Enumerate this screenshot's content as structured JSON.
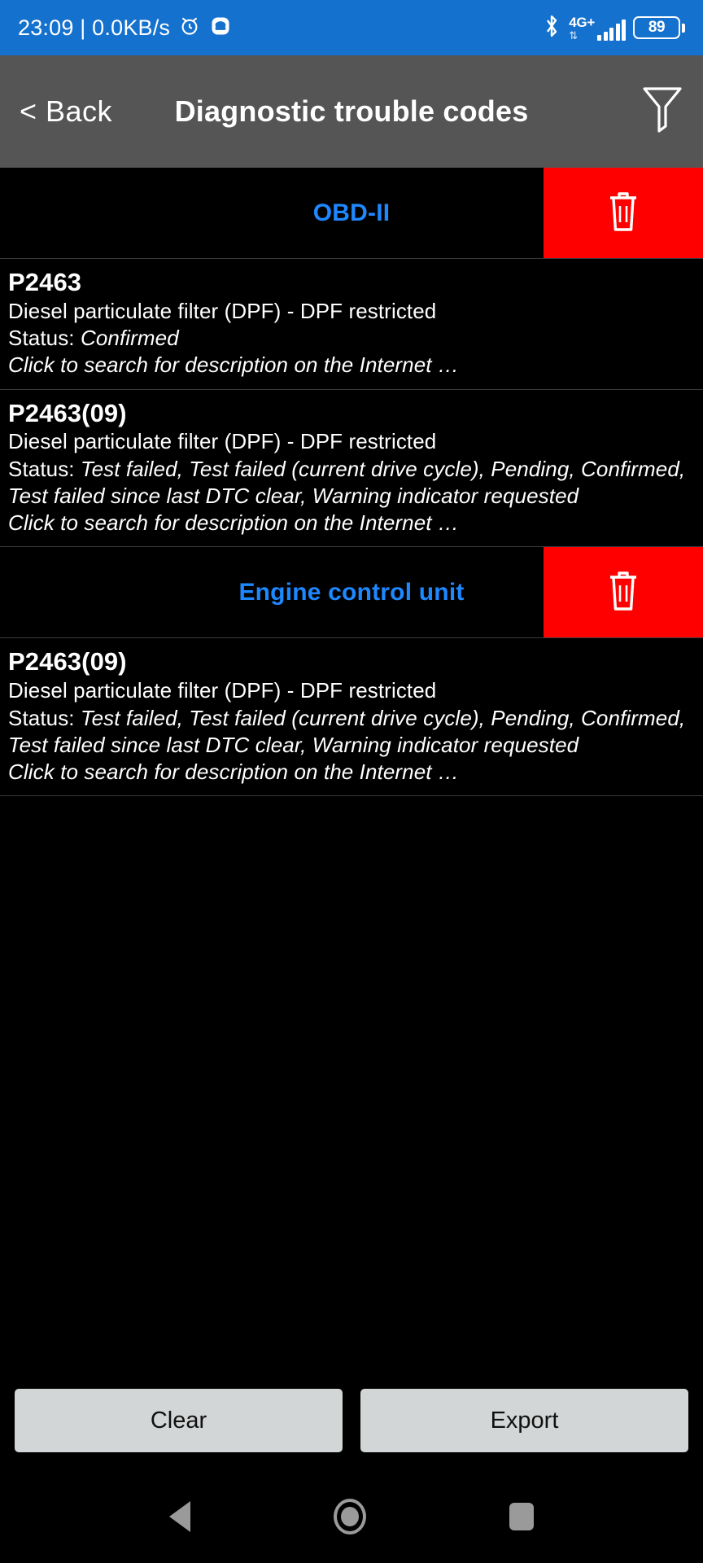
{
  "statusbar": {
    "clock": "23:09 | 0.0KB/s",
    "alarm_icon": "alarm-clock-icon",
    "app_icon": "app-notification-icon",
    "bluetooth_icon": "bluetooth-icon",
    "network_label": "4G+",
    "network_arrows": "⇅",
    "signal_icon": "signal-bars-icon",
    "battery_level": "89",
    "bar_color": "#1571ce"
  },
  "header": {
    "back_label": "< Back",
    "title": "Diagnostic trouble codes",
    "filter_icon": "filter-funnel-icon",
    "bg_color": "#555555"
  },
  "groups": [
    {
      "title": "OBD-II",
      "title_color": "#1e88ff",
      "delete_icon": "trash-icon",
      "delete_color": "#fe0000",
      "entries": [
        {
          "code": "P2463",
          "description": "Diesel particulate filter (DPF) - DPF restricted",
          "status_label": "Status: ",
          "status_value": "Confirmed",
          "link": "Click to search for description on the Internet …"
        },
        {
          "code": "P2463(09)",
          "description": "Diesel particulate filter (DPF) - DPF restricted",
          "status_label": "Status: ",
          "status_value": "Test failed, Test failed (current drive cycle), Pending, Confirmed, Test failed since last DTC clear, Warning indicator requested",
          "link": "Click to search for description on the Internet …"
        }
      ]
    },
    {
      "title": "Engine control unit",
      "title_color": "#1e88ff",
      "delete_icon": "trash-icon",
      "delete_color": "#fe0000",
      "entries": [
        {
          "code": "P2463(09)",
          "description": "Diesel particulate filter (DPF) - DPF restricted",
          "status_label": "Status: ",
          "status_value": "Test failed, Test failed (current drive cycle), Pending, Confirmed, Test failed since last DTC clear, Warning indicator requested",
          "link": "Click to search for description on the Internet …"
        }
      ]
    }
  ],
  "actions": {
    "clear_label": "Clear",
    "export_label": "Export"
  },
  "navbar": {
    "back_icon": "nav-back-triangle-icon",
    "home_icon": "nav-home-circle-icon",
    "recents_icon": "nav-recents-square-icon"
  }
}
